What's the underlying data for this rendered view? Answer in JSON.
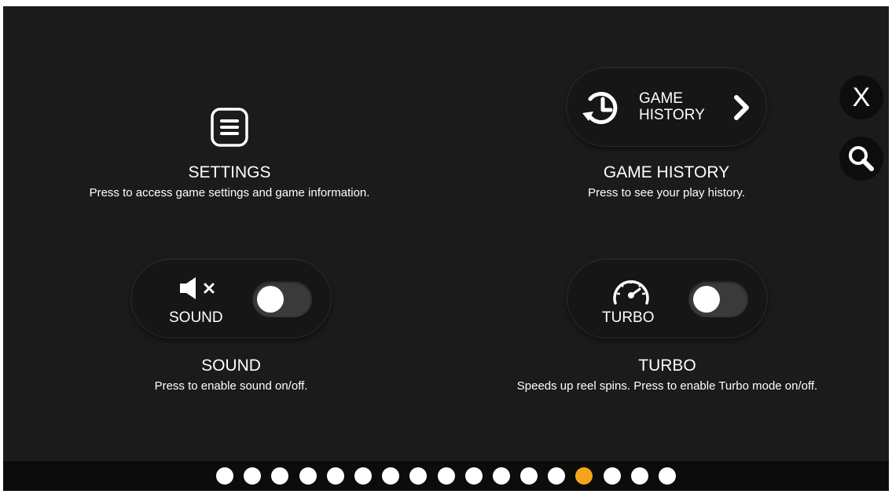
{
  "close_button": {
    "label": "X"
  },
  "settings": {
    "title": "SETTINGS",
    "description": "Press to access game settings and game information."
  },
  "game_history": {
    "button_label_line1": "GAME",
    "button_label_line2": "HISTORY",
    "title": "GAME HISTORY",
    "description": "Press to see your play history."
  },
  "sound": {
    "button_label": "SOUND",
    "title": "SOUND",
    "description": "Press to enable sound on/off.",
    "enabled": false
  },
  "turbo": {
    "button_label": "TURBO",
    "title": "TURBO",
    "description": "Speeds up reel spins. Press to enable Turbo mode on/off.",
    "enabled": false
  },
  "pagination": {
    "total_pages": 17,
    "active_page": 14,
    "active_color": "#f5a41b",
    "inactive_color": "#ffffff"
  },
  "colors": {
    "background": "#1b1b1b",
    "footer": "#0c0c0c",
    "text": "#ffffff"
  },
  "icons": {
    "settings": "menu-icon",
    "game_history": "history-clock-icon",
    "chevron": "chevron-right-icon",
    "sound": "speaker-muted-icon",
    "turbo": "speedometer-icon",
    "close": "close-icon",
    "search": "search-icon"
  }
}
